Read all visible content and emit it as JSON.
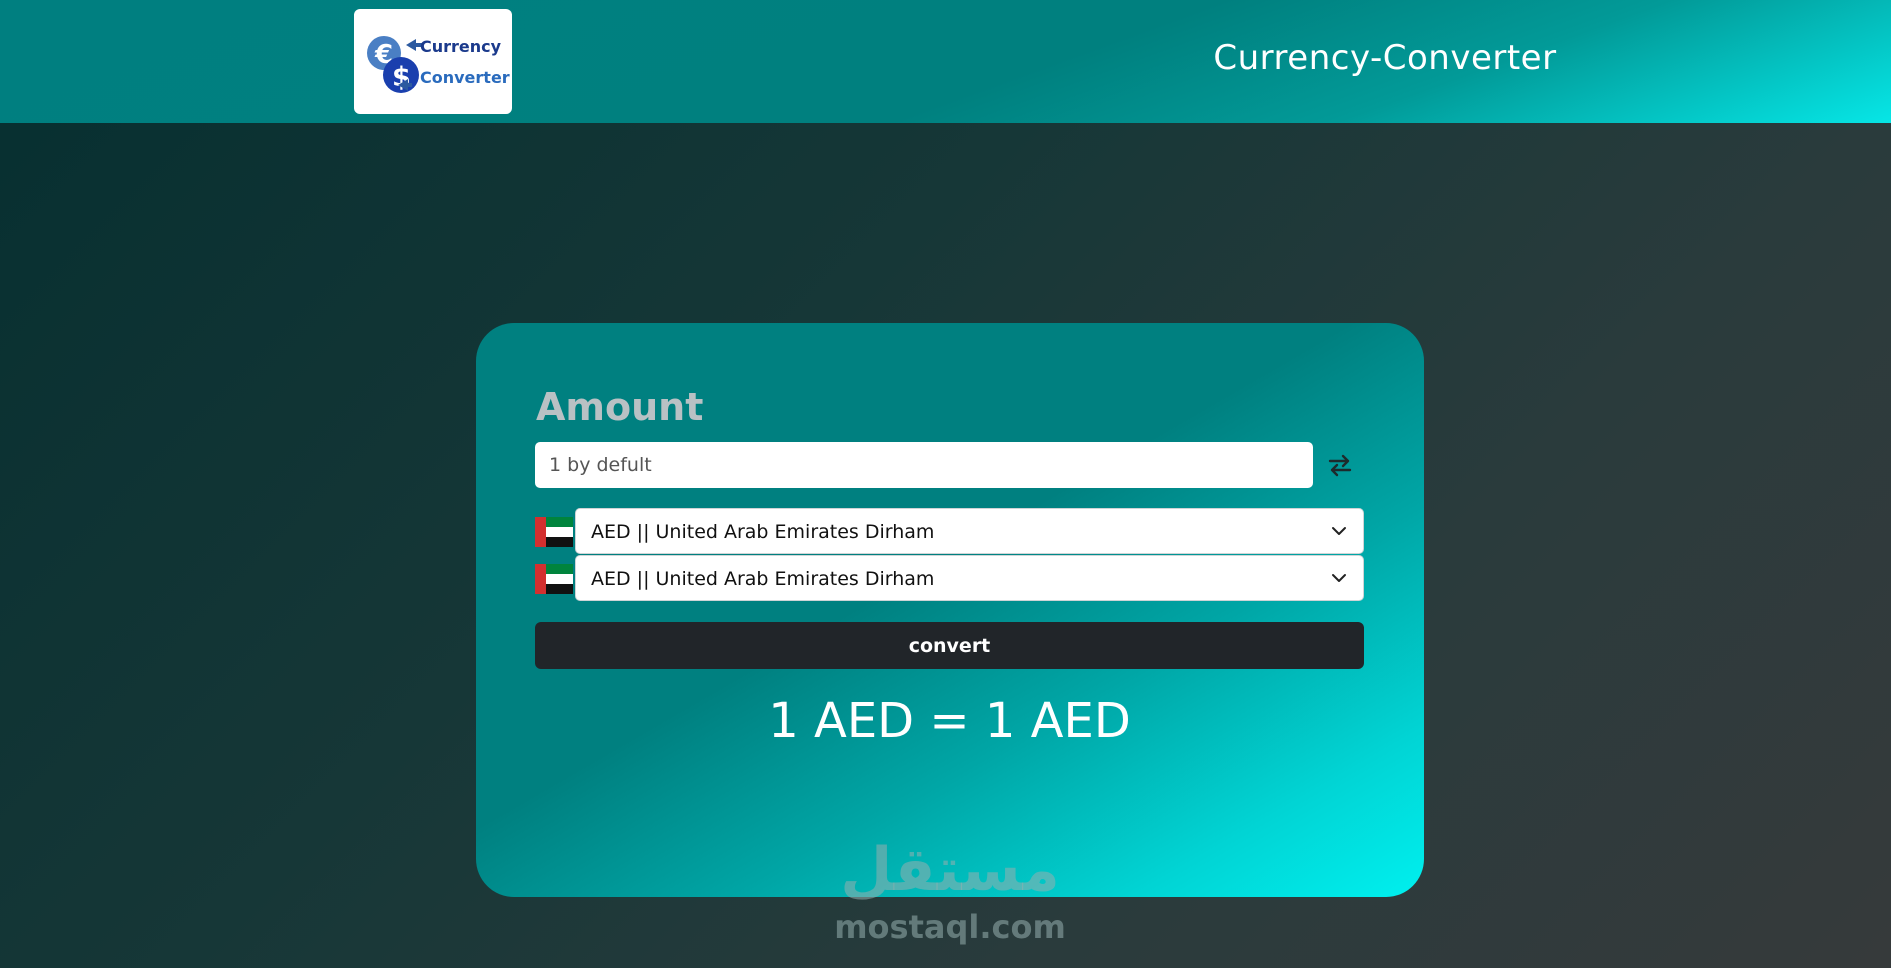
{
  "header": {
    "logo": {
      "line1": "Currency",
      "line2": "Converter",
      "icon": "currency-exchange-icon"
    },
    "title": "Currency-Converter"
  },
  "converter": {
    "amount_label": "Amount",
    "amount_input": {
      "value": "",
      "placeholder": "1 by defult"
    },
    "swap_icon": "swap-arrows-icon",
    "from_currency": {
      "flag_icon": "uae-flag-icon",
      "selected": "AED || United Arab Emirates Dirham"
    },
    "to_currency": {
      "flag_icon": "uae-flag-icon",
      "selected": "AED || United Arab Emirates Dirham"
    },
    "convert_label": "convert",
    "result": "1 AED = 1 AED"
  },
  "watermark": {
    "arabic": "مستقل",
    "latin": "mostaql.com"
  },
  "colors": {
    "header_teal": "#008080",
    "card_teal": "#008080",
    "card_cyan": "#00f0ef",
    "button_dark": "#212529"
  }
}
